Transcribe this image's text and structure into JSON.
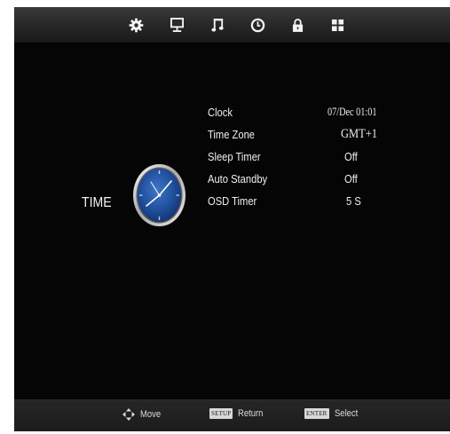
{
  "tabs": [
    {
      "name": "picture",
      "icon": "gear-icon"
    },
    {
      "name": "screen",
      "icon": "monitor-icon"
    },
    {
      "name": "sound",
      "icon": "music-note-icon"
    },
    {
      "name": "time",
      "icon": "clock-icon"
    },
    {
      "name": "lock",
      "icon": "lock-icon"
    },
    {
      "name": "setup",
      "icon": "grid-icon"
    }
  ],
  "section": {
    "title": "TIME",
    "icon": "analog-clock-icon"
  },
  "menu": {
    "clock_label": "Clock",
    "clock_value": "07/Dec 01:01",
    "timezone_label": "Time Zone",
    "timezone_value": "GMT+1",
    "sleep_label": "Sleep Timer",
    "sleep_value": "Off",
    "standby_label": "Auto Standby",
    "standby_value": "Off",
    "osd_label": "OSD Timer",
    "osd_value": "5 S"
  },
  "footer": {
    "move_label": "Move",
    "setup_key": "SETUP",
    "return_label": "Return",
    "enter_key": "ENTER",
    "select_label": "Select"
  },
  "colors": {
    "background": "#050505",
    "bar": "#2a2a2a",
    "text": "#f0f0f0",
    "clock_face": "#1f4e9c"
  }
}
